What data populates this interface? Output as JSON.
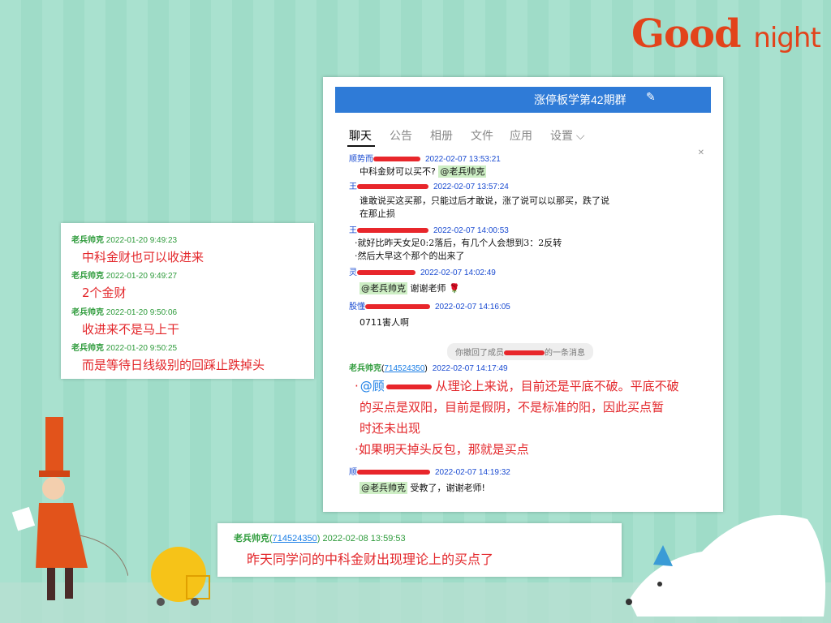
{
  "banner": {
    "good": "Good",
    "night": "night"
  },
  "chat": {
    "title": "涨停板学第42期群",
    "tabs": [
      "聊天",
      "公告",
      "相册",
      "文件",
      "应用",
      "设置 ⌵"
    ],
    "messages": [
      {
        "name": "顺势而",
        "time": "2022-02-07 13:53:21",
        "lines": [
          "中科金财可以买不? "
        ],
        "mention": "@老兵帅克"
      },
      {
        "name": "王",
        "time": "2022-02-07 13:57:24",
        "lines": [
          "谁敢说买这买那，只能过后才敢说，涨了说可以以那买，跌了说",
          "在那止损"
        ]
      },
      {
        "name": "王",
        "time": "2022-02-07 14:00:53",
        "lines": [
          "·就好比昨天女足0:2落后，有几个人会想到3：2反转",
          "·然后大早这个那个的出来了"
        ]
      },
      {
        "name": "灵",
        "time": "2022-02-07 14:02:49",
        "mention": "@老兵帅克",
        "lines": [
          " 谢谢老师"
        ]
      },
      {
        "name": "股懂",
        "time": "2022-02-07 14:16:05",
        "lines": [
          "0711害人啊"
        ]
      },
      {
        "recall": "你撤回了成员",
        "recall_suffix": "的一条消息"
      },
      {
        "name": "老兵帅克",
        "qq": "714524350",
        "time": "2022-02-07 14:17:49",
        "mention": "@顾",
        "lines": [
          " 从理论上来说，目前还是平底不破。平底不破",
          "的买点是双阳，目前是假阴，不是标准的阳，因此买点暂",
          "时还未出现",
          "·如果明天掉头反包，那就是买点"
        ]
      },
      {
        "name": "顺",
        "time": "2022-02-07 14:19:32",
        "mention": "@老兵帅克",
        "lines": [
          " 受教了，谢谢老师!"
        ]
      }
    ]
  },
  "left_card": {
    "entries": [
      {
        "name": "老兵帅克",
        "time": "2022-01-20 9:49:23",
        "text": "中科金财也可以收进来"
      },
      {
        "name": "老兵帅克",
        "time": "2022-01-20 9:49:27",
        "text": "2个金财"
      },
      {
        "name": "老兵帅克",
        "time": "2022-01-20 9:50:06",
        "text": "收进来不是马上干"
      },
      {
        "name": "老兵帅克",
        "time": "2022-01-20 9:50:25",
        "text": "而是等待日线级别的回踩止跌掉头"
      }
    ]
  },
  "bottom_card": {
    "name": "老兵帅克",
    "qq": "714524350",
    "time": "2022-02-08 13:59:53",
    "text": "昨天同学问的中科金财出现理论上的买点了"
  },
  "colors": {
    "header": "#2f7bd7",
    "accent_red": "#e3272b",
    "name_green": "#2e9b3b",
    "name_blue": "#1a4bd1",
    "background": "#a9e1cf"
  }
}
